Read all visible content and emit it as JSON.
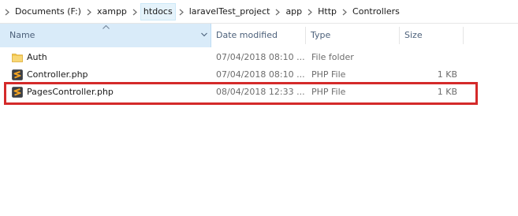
{
  "breadcrumb": {
    "items": [
      "Documents (F:)",
      "xampp",
      "htdocs",
      "laravelTest_project",
      "app",
      "Http",
      "Controllers"
    ],
    "selected_index": 2
  },
  "columns": {
    "name": "Name",
    "date_modified": "Date modified",
    "type": "Type",
    "size": "Size",
    "sort_column": "Name",
    "sort_direction": "ascending"
  },
  "files": [
    {
      "name": "Auth",
      "date_modified": "07/04/2018 08:10 ...",
      "type": "File folder",
      "size": "",
      "icon": "folder-icon"
    },
    {
      "name": "Controller.php",
      "date_modified": "07/04/2018 08:10 ...",
      "type": "PHP File",
      "size": "1 KB",
      "icon": "sublime-php-file-icon"
    },
    {
      "name": "PagesController.php",
      "date_modified": "08/04/2018 12:33 ...",
      "type": "PHP File",
      "size": "1 KB",
      "icon": "sublime-php-file-icon",
      "highlighted": true
    }
  ],
  "colors": {
    "accent": "#d42a2a",
    "header_text": "#4c607a",
    "selected_crumb_bg": "#e5f3fb",
    "folder": "#f3c74e",
    "file_icon": "#f2a221"
  }
}
